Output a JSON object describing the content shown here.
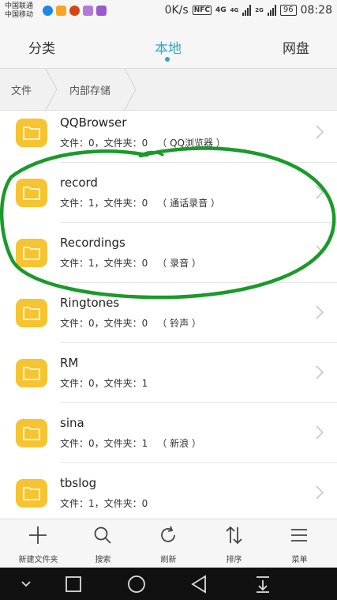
{
  "status": {
    "carrier1": "中国联通",
    "carrier2": "中国移动",
    "speed": "0K/s",
    "nfc": "NFC",
    "net1": "4G",
    "net1b": "4G",
    "net2": "2G",
    "battery": "96",
    "time": "08:28"
  },
  "tabs": {
    "classify": "分类",
    "local": "本地",
    "cloud": "网盘"
  },
  "breadcrumb": {
    "root": "文件",
    "current": "内部存储"
  },
  "files": [
    {
      "name": "QQBrowser",
      "files": "文件：0，",
      "folders": "文件夹：0",
      "alias": "（ QQ浏览器 ）"
    },
    {
      "name": "record",
      "files": "文件：1，",
      "folders": "文件夹：0",
      "alias": "（ 通话录音 ）"
    },
    {
      "name": "Recordings",
      "files": "文件：1，",
      "folders": "文件夹：0",
      "alias": "（ 录音 ）"
    },
    {
      "name": "Ringtones",
      "files": "文件：0，",
      "folders": "文件夹：0",
      "alias": "（ 铃声 ）"
    },
    {
      "name": "RM",
      "files": "文件：0，",
      "folders": "文件夹：1",
      "alias": ""
    },
    {
      "name": "sina",
      "files": "文件：0，",
      "folders": "文件夹：1",
      "alias": "（ 新浪 ）"
    },
    {
      "name": "tbslog",
      "files": "文件：1，",
      "folders": "文件夹：0",
      "alias": ""
    }
  ],
  "toolbar": {
    "new_folder": "新建文件夹",
    "search": "搜索",
    "refresh": "刷新",
    "sort": "排序",
    "menu": "菜单"
  },
  "icons": {
    "folder": "folder-icon",
    "chevron": "chevron-right-icon",
    "add": "plus-icon",
    "search": "search-icon",
    "refresh": "refresh-icon",
    "sort": "sort-icon",
    "menu": "menu-icon"
  },
  "colors": {
    "accent": "#2aa6c9",
    "folder": "#f6c431",
    "annotation": "#1a9a2a"
  }
}
